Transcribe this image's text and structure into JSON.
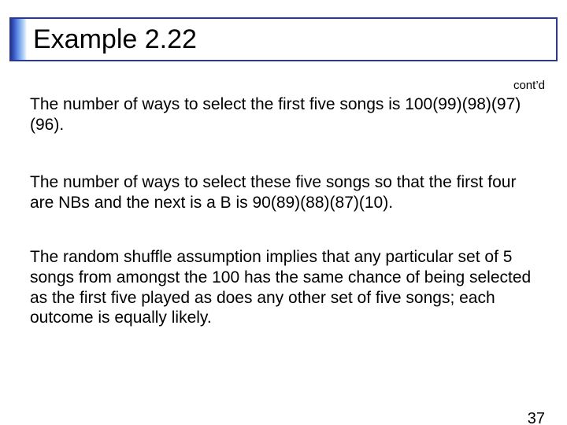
{
  "title": "Example 2.22",
  "contd": "cont’d",
  "para1": "The number of ways to select the first five songs is 100(99)(98)(97)(96).",
  "para2": "The number of ways to select these five songs so that the first four are NBs and the next is a B is 90(89)(88)(87)(10).",
  "para3": "The random shuffle assumption implies that any particular set of 5 songs from amongst the 100 has the same chance of being selected as the first five played as does any other set of five songs; each outcome is equally likely.",
  "page_number": "37"
}
